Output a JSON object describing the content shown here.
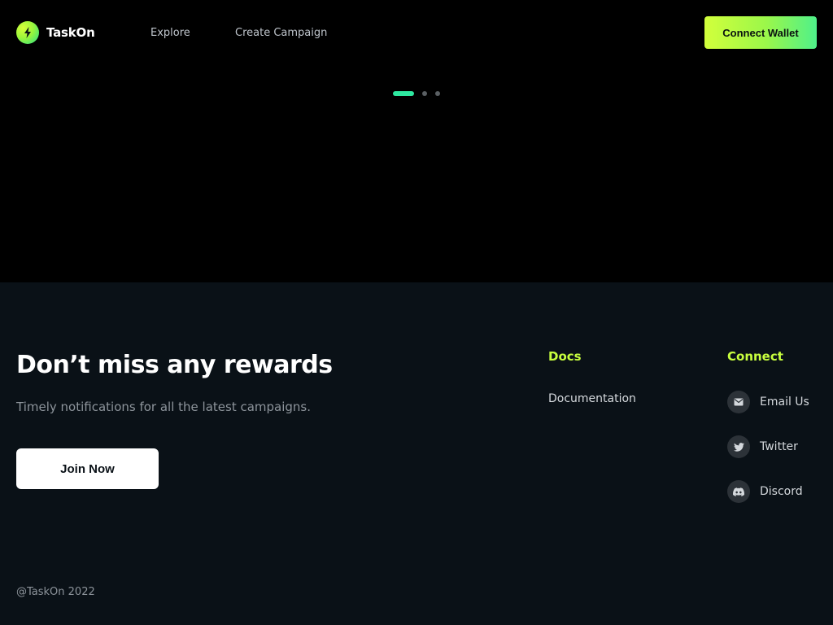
{
  "header": {
    "logo_text": "TaskOn",
    "nav": {
      "explore": "Explore",
      "create_campaign": "Create Campaign"
    },
    "connect_wallet": "Connect Wallet"
  },
  "carousel": {
    "slide_count": 3,
    "active_index": 0
  },
  "footer": {
    "headline": "Don’t miss any rewards",
    "subtext": "Timely notifications for all the latest campaigns.",
    "join_button": "Join Now",
    "docs": {
      "title": "Docs",
      "links": [
        "Documentation"
      ]
    },
    "connect": {
      "title": "Connect",
      "links": [
        {
          "label": "Email Us",
          "icon": "email-icon"
        },
        {
          "label": "Twitter",
          "icon": "twitter-icon"
        },
        {
          "label": "Discord",
          "icon": "discord-icon"
        }
      ]
    },
    "copyright": "@TaskOn 2022"
  },
  "colors": {
    "accent_lime": "#c8ff3e",
    "accent_green": "#2ee8a0",
    "footer_bg": "#0a1117",
    "page_bg": "#000000"
  }
}
